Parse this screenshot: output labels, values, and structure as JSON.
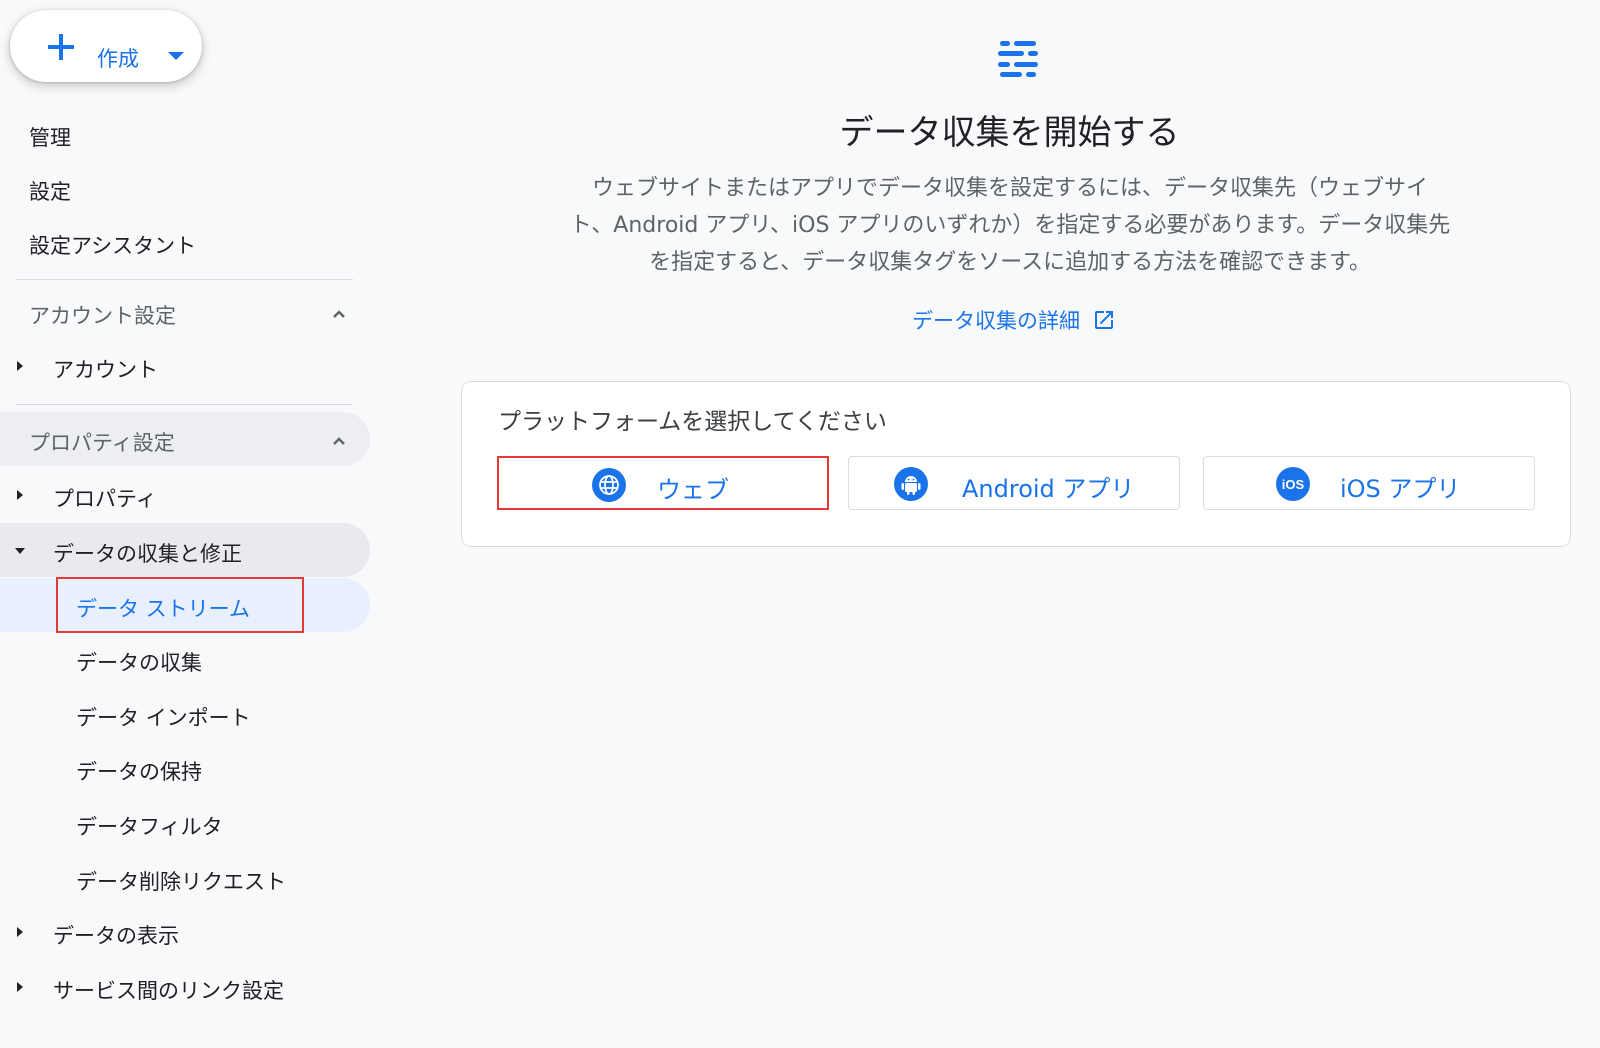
{
  "create_button": {
    "label": "作成"
  },
  "nav": {
    "admin": "管理",
    "settings": "設定",
    "setup_assistant": "設定アシスタント"
  },
  "account_section": {
    "title": "アカウント設定",
    "items": [
      {
        "label": "アカウント"
      }
    ]
  },
  "property_section": {
    "title": "プロパティ設定",
    "property": "プロパティ",
    "data_collection": {
      "label": "データの収集と修正",
      "children": [
        {
          "label": "データ ストリーム"
        },
        {
          "label": "データの収集"
        },
        {
          "label": "データ インポート"
        },
        {
          "label": "データの保持"
        },
        {
          "label": "データフィルタ"
        },
        {
          "label": "データ削除リクエスト"
        }
      ]
    },
    "data_display": "データの表示",
    "service_links": "サービス間のリンク設定"
  },
  "main": {
    "title": "データ収集を開始する",
    "description_lines": [
      "ウェブサイトまたはアプリでデータ収集を設定するには、データ収集先（ウェブサイ",
      "ト、Android アプリ、iOS アプリのいずれか）を指定する必要があります。データ収集先",
      "を指定すると、データ収集タグをソースに追加する方法を確認できます。"
    ],
    "learn_more": "データ収集の詳細",
    "platform_card": {
      "title": "プラットフォームを選択してください",
      "buttons": [
        {
          "label": "ウェブ",
          "icon": "globe-icon"
        },
        {
          "label": "Android アプリ",
          "icon": "android-icon"
        },
        {
          "label": "iOS アプリ",
          "icon": "ios-icon"
        }
      ]
    }
  },
  "colors": {
    "accent": "#1a73e8",
    "highlight_border": "#e53935"
  }
}
